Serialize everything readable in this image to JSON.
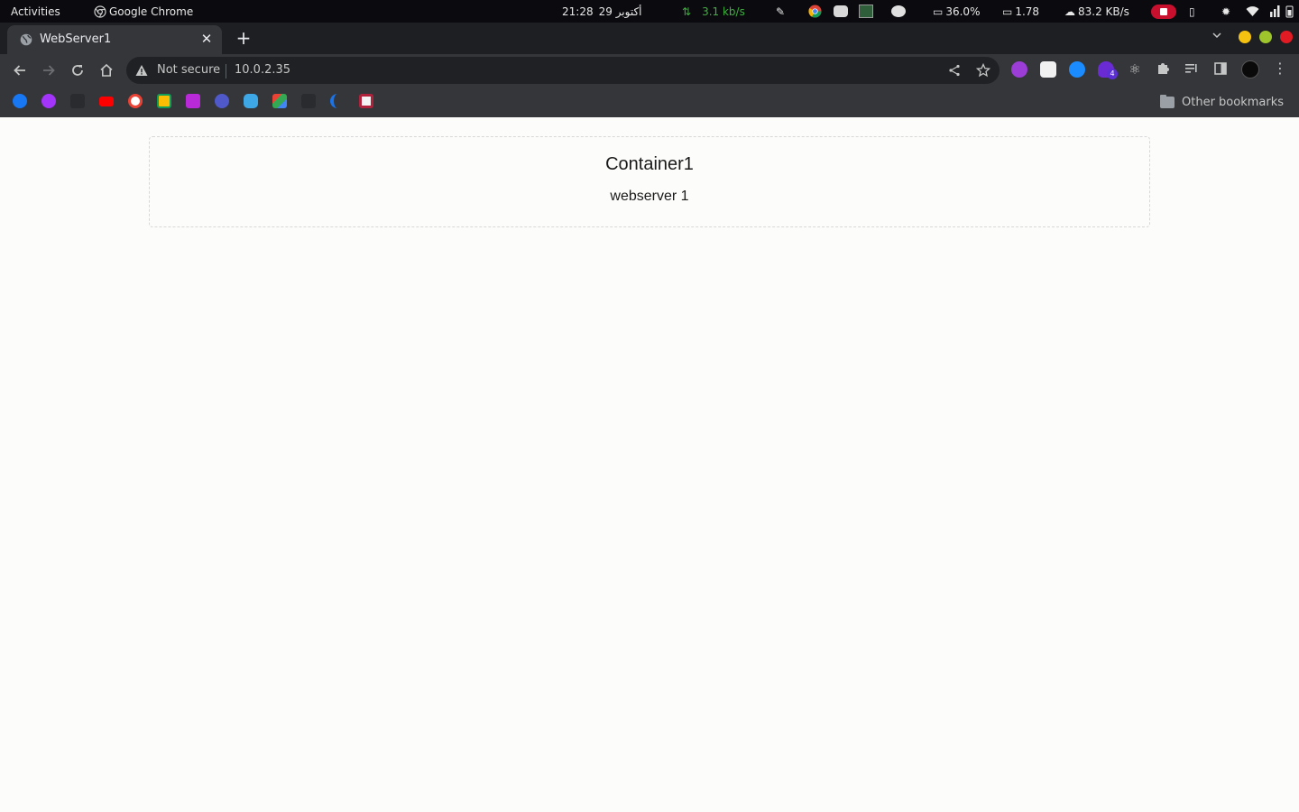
{
  "system_bar": {
    "activities": "Activities",
    "app_name": "Google Chrome",
    "clock": "21:28",
    "date": "29 أكتوبر",
    "net_speed": "3.1 kb/s",
    "cpu": "36.0%",
    "load": "1.78",
    "download": "83.2 KB/s"
  },
  "browser": {
    "tab_title": "WebServer1",
    "tab_close": "✕",
    "new_tab": "+",
    "security_label": "Not secure",
    "url": "10.0.2.35",
    "extension_badge": "4",
    "other_bookmarks": "Other bookmarks",
    "window_buttons": [
      "#f5c211",
      "#9ec62c",
      "#e01b24"
    ]
  },
  "page": {
    "heading": "Container1",
    "subtext": "webserver 1"
  },
  "colors": {
    "accent_green": "#3fae3f",
    "record_red": "#c8102e",
    "page_bg": "#fcfcfb"
  }
}
